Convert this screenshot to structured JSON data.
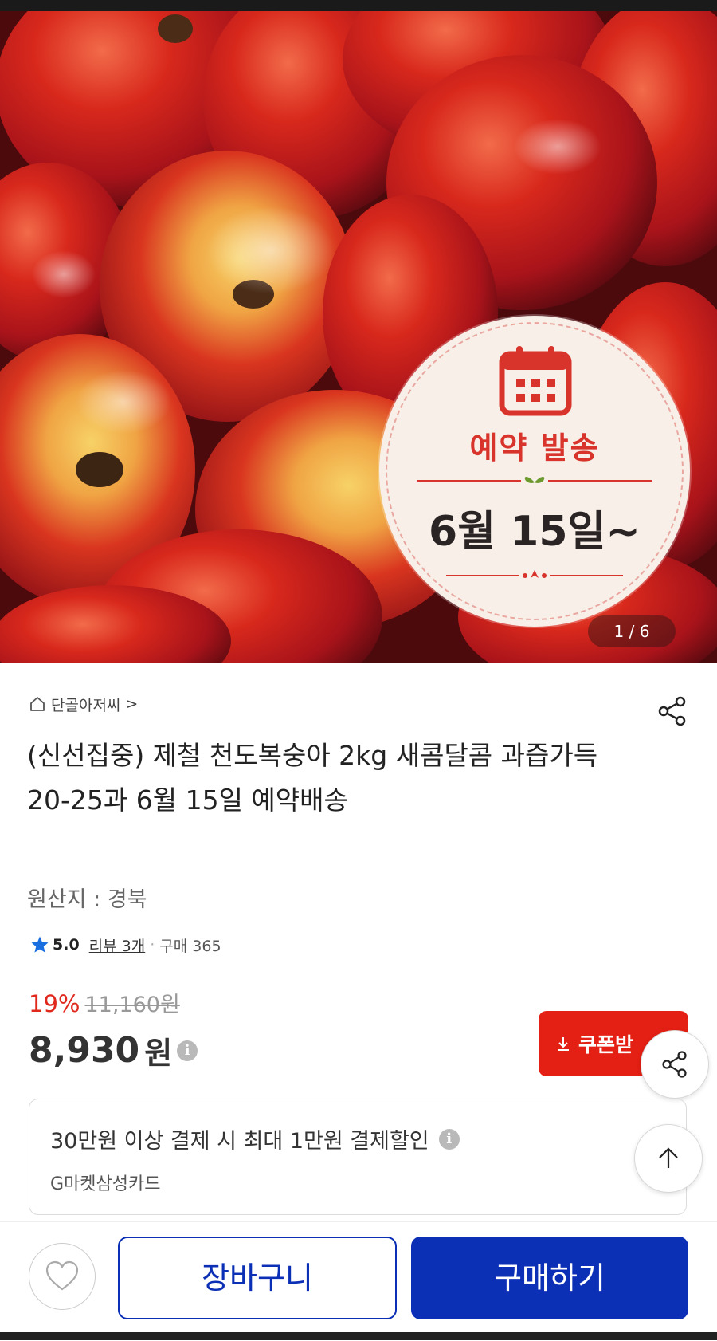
{
  "hero": {
    "badge_title": "예약 발송",
    "badge_date": "6월 15일~",
    "pager": "1 / 6"
  },
  "seller": {
    "name": "단골아저씨",
    "chevron": ">"
  },
  "product": {
    "title": "(신선집중) 제철 천도복숭아 2kg 새콤달콤 과즙가득 20-25과  6월 15일 예약배송",
    "origin": "원산지 : 경북"
  },
  "rating": {
    "score": "5.0",
    "reviews": "리뷰 3개",
    "separator": "·",
    "purchases": "구매 365"
  },
  "price": {
    "discount": "19%",
    "original": "11,160원",
    "current": "8,930",
    "unit": "원",
    "info_glyph": "i"
  },
  "coupon": {
    "label": "쿠폰받"
  },
  "card_promo": {
    "main": "30만원 이상 결제 시 최대 1만원 결제할인",
    "sub": "G마켓삼성카드",
    "info_glyph": "i"
  },
  "actions": {
    "cart": "장바구니",
    "buy": "구매하기"
  },
  "colors": {
    "accent_red": "#e41f13",
    "primary_blue": "#0b2fb5",
    "star": "#1a6fe0"
  },
  "icons": [
    "home-icon",
    "share-icon",
    "star-icon",
    "download-icon",
    "arrow-up-icon",
    "heart-icon",
    "calendar-icon",
    "info-icon"
  ]
}
